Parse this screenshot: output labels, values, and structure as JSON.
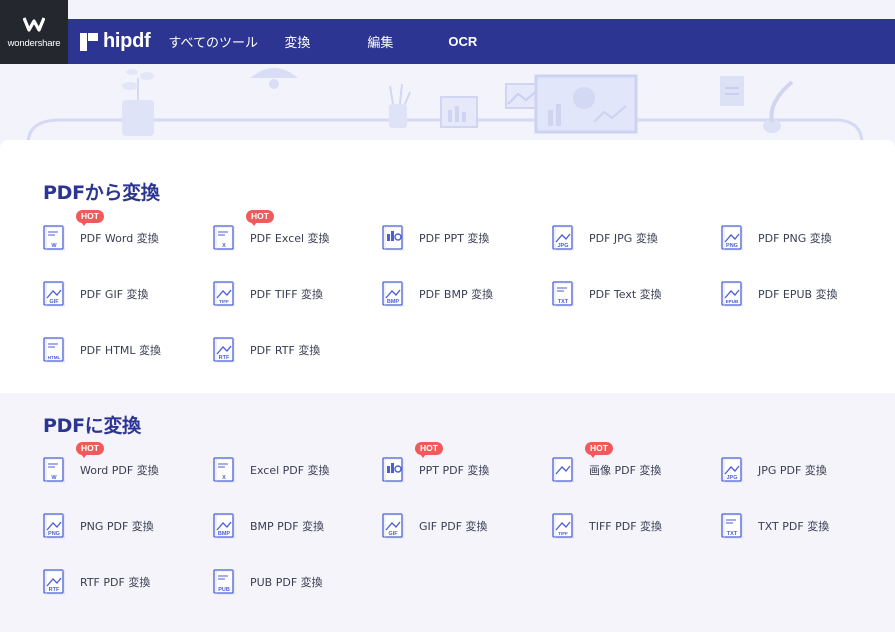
{
  "header": {
    "company": "wondershare",
    "brand": "hipdf",
    "nav": [
      "すべてのツール",
      "変換",
      "編集",
      "OCR"
    ]
  },
  "from_pdf": {
    "title": "PDFから変換",
    "tools": [
      {
        "label": "PDF Word 変換",
        "hot": true,
        "tag": "W"
      },
      {
        "label": "PDF Excel 変換",
        "hot": true,
        "tag": "X"
      },
      {
        "label": "PDF PPT 変換",
        "hot": false,
        "tag": ""
      },
      {
        "label": "PDF JPG 変換",
        "hot": false,
        "tag": "JPG"
      },
      {
        "label": "PDF PNG 変換",
        "hot": false,
        "tag": "PNG"
      },
      {
        "label": "PDF GIF 変換",
        "hot": false,
        "tag": "GIF"
      },
      {
        "label": "PDF TIFF 変換",
        "hot": false,
        "tag": "TIFF"
      },
      {
        "label": "PDF BMP 変換",
        "hot": false,
        "tag": "BMP"
      },
      {
        "label": "PDF Text 変換",
        "hot": false,
        "tag": "TXT"
      },
      {
        "label": "PDF EPUB 変換",
        "hot": false,
        "tag": "EPUB"
      },
      {
        "label": "PDF HTML 変換",
        "hot": false,
        "tag": "HTML"
      },
      {
        "label": "PDF RTF 変換",
        "hot": false,
        "tag": "RTF"
      }
    ]
  },
  "to_pdf": {
    "title": "PDFに変換",
    "tools": [
      {
        "label": "Word PDF 変換",
        "hot": true,
        "tag": "W"
      },
      {
        "label": "Excel PDF 変換",
        "hot": false,
        "tag": "X"
      },
      {
        "label": "PPT PDF 変換",
        "hot": true,
        "tag": ""
      },
      {
        "label": "画像 PDF 変換",
        "hot": true,
        "tag": ""
      },
      {
        "label": "JPG PDF 変換",
        "hot": false,
        "tag": "JPG"
      },
      {
        "label": "PNG PDF 変換",
        "hot": false,
        "tag": "PNG"
      },
      {
        "label": "BMP PDF 変換",
        "hot": false,
        "tag": "BMP"
      },
      {
        "label": "GIF PDF 変換",
        "hot": false,
        "tag": "GIF"
      },
      {
        "label": "TIFF PDF 変換",
        "hot": false,
        "tag": "TIFF"
      },
      {
        "label": "TXT PDF 変換",
        "hot": false,
        "tag": "TXT"
      },
      {
        "label": "RTF PDF 変換",
        "hot": false,
        "tag": "RTF"
      },
      {
        "label": "PUB PDF 変換",
        "hot": false,
        "tag": "PUB"
      }
    ]
  },
  "hot_label": "HOT",
  "colors": {
    "navy": "#2c3592",
    "hot": "#f05a5a",
    "icon": "#4a5dd6",
    "logo_bg": "#25272f"
  }
}
